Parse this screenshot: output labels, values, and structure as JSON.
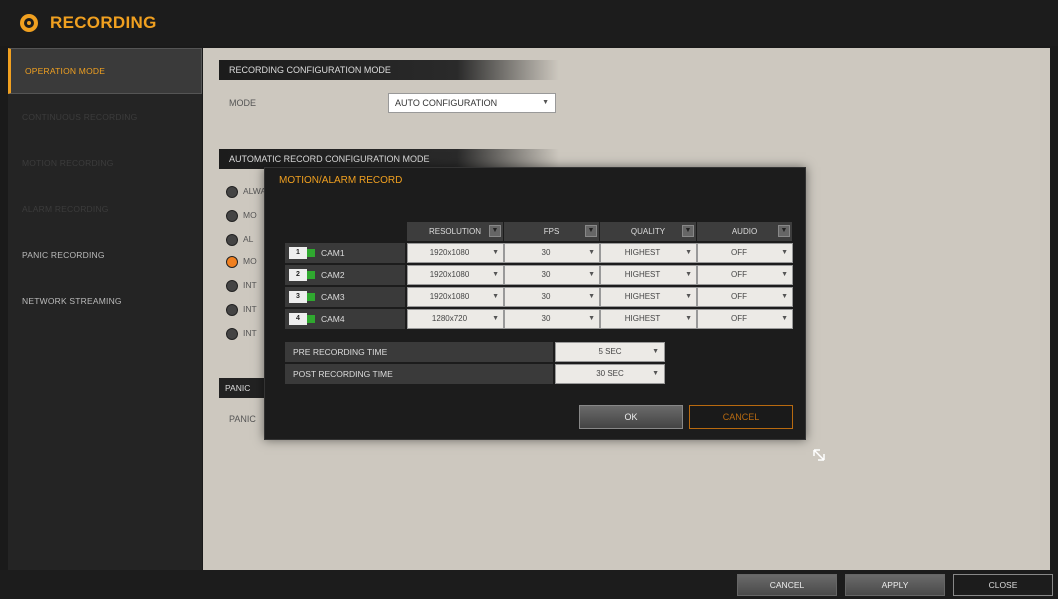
{
  "window": {
    "title": "RECORDING"
  },
  "sidebar": {
    "items": [
      {
        "label": "OPERATION MODE",
        "state": "active"
      },
      {
        "label": "CONTINUOUS RECORDING",
        "state": "disabled"
      },
      {
        "label": "MOTION RECORDING",
        "state": "disabled"
      },
      {
        "label": "ALARM RECORDING",
        "state": "disabled"
      },
      {
        "label": "PANIC RECORDING",
        "state": "normal"
      },
      {
        "label": "NETWORK STREAMING",
        "state": "normal"
      }
    ]
  },
  "main": {
    "config_header": "RECORDING CONFIGURATION MODE",
    "mode_label": "MODE",
    "mode_value": "AUTO CONFIGURATION",
    "auto_header": "AUTOMATIC RECORD CONFIGURATION MODE",
    "radio_options": [
      {
        "label": "ALWAYS",
        "selected": false
      },
      {
        "label": "MO",
        "selected": false
      },
      {
        "label": "AL",
        "selected": false
      },
      {
        "label": "MO",
        "selected": true
      },
      {
        "label": "INT",
        "selected": false
      },
      {
        "label": "INT",
        "selected": false
      },
      {
        "label": "INT",
        "selected": false
      }
    ],
    "panic_header": "PANIC",
    "panic_label": "PANIC"
  },
  "dialog": {
    "title": "MOTION/ALARM RECORD",
    "columns": [
      "RESOLUTION",
      "FPS",
      "QUALITY",
      "AUDIO"
    ],
    "cameras": [
      {
        "badge": "1",
        "name": "CAM1",
        "resolution": "1920x1080",
        "fps": "30",
        "quality": "HIGHEST",
        "audio": "OFF"
      },
      {
        "badge": "2",
        "name": "CAM2",
        "resolution": "1920x1080",
        "fps": "30",
        "quality": "HIGHEST",
        "audio": "OFF"
      },
      {
        "badge": "3",
        "name": "CAM3",
        "resolution": "1920x1080",
        "fps": "30",
        "quality": "HIGHEST",
        "audio": "OFF"
      },
      {
        "badge": "4",
        "name": "CAM4",
        "resolution": "1280x720",
        "fps": "30",
        "quality": "HIGHEST",
        "audio": "OFF"
      }
    ],
    "pre_recording_label": "PRE RECORDING TIME",
    "pre_recording_value": "5 SEC",
    "post_recording_label": "POST RECORDING TIME",
    "post_recording_value": "30 SEC",
    "ok_label": "OK",
    "cancel_label": "CANCEL"
  },
  "bottom": {
    "cancel_label": "CANCEL",
    "apply_label": "APPLY",
    "close_label": "CLOSE"
  },
  "colors": {
    "accent": "#f0a020",
    "panel": "#cdc8bf",
    "dark": "#1c1c1c"
  },
  "icons": {
    "title": "recording-reel-icon",
    "dropdown": "chevron-down-icon",
    "cursor": "mouse-pointer-icon"
  }
}
